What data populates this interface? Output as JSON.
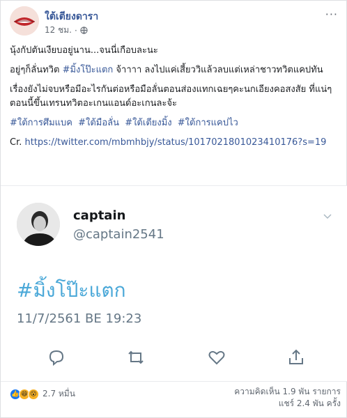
{
  "header": {
    "page_name": "ใต้เตียงดารา",
    "time": "12 ชม.",
    "time_separator": "·",
    "menu": "···"
  },
  "body": {
    "line1": "นุ้งกัปตันเงียบอยู่นาน...จนนี่เกือบละนะ",
    "line2_a": "อยู่ๆก็ลั่นทวิต ",
    "line2_hashtag": "#มิ้งโป๊ะแตก",
    "line2_b": " จ้าาาา ลงไปแค่เสี้ยววิแล้วลบแต่เหล่าชาวทวิตแคปทัน",
    "line3": "เรื่องยังไม่จบหรือมีอะไรกันต่อหรือมือลั่นตอนส่องแทกเฉยๆคะนกเอียงคอสงสัย ที่แน่ๆตอนนี้ขึ้นเทรนทวิตอะเกนแอนด์อะเกนละจ้ะ",
    "hashtags": [
      "#ใต้การศึมแบค",
      "#ใต้มือลั่น",
      "#ใต้เตียงมิ้ง",
      "#ใต้การแคปไว"
    ],
    "credit_prefix": "Cr. ",
    "credit_url": "https://twitter.com/mbmhbjy/status/1017021801023410176?s=19"
  },
  "tweet": {
    "name": "captain",
    "handle": "@captain2541",
    "hashtag": "#มิ้งโป๊ะแตก",
    "date": "11/7/2561 BE 19:23"
  },
  "footer": {
    "reaction_count": "2.7 หมื่น",
    "comments": "ความคิดเห็น 1.9 พัน รายการ",
    "shares": "แชร์ 2.4 พัน ครั้ง"
  },
  "colors": {
    "link": "#385898",
    "tweet_hashtag": "#4aa8d8",
    "like": "#1877f2",
    "emoji": "#f7b125"
  }
}
